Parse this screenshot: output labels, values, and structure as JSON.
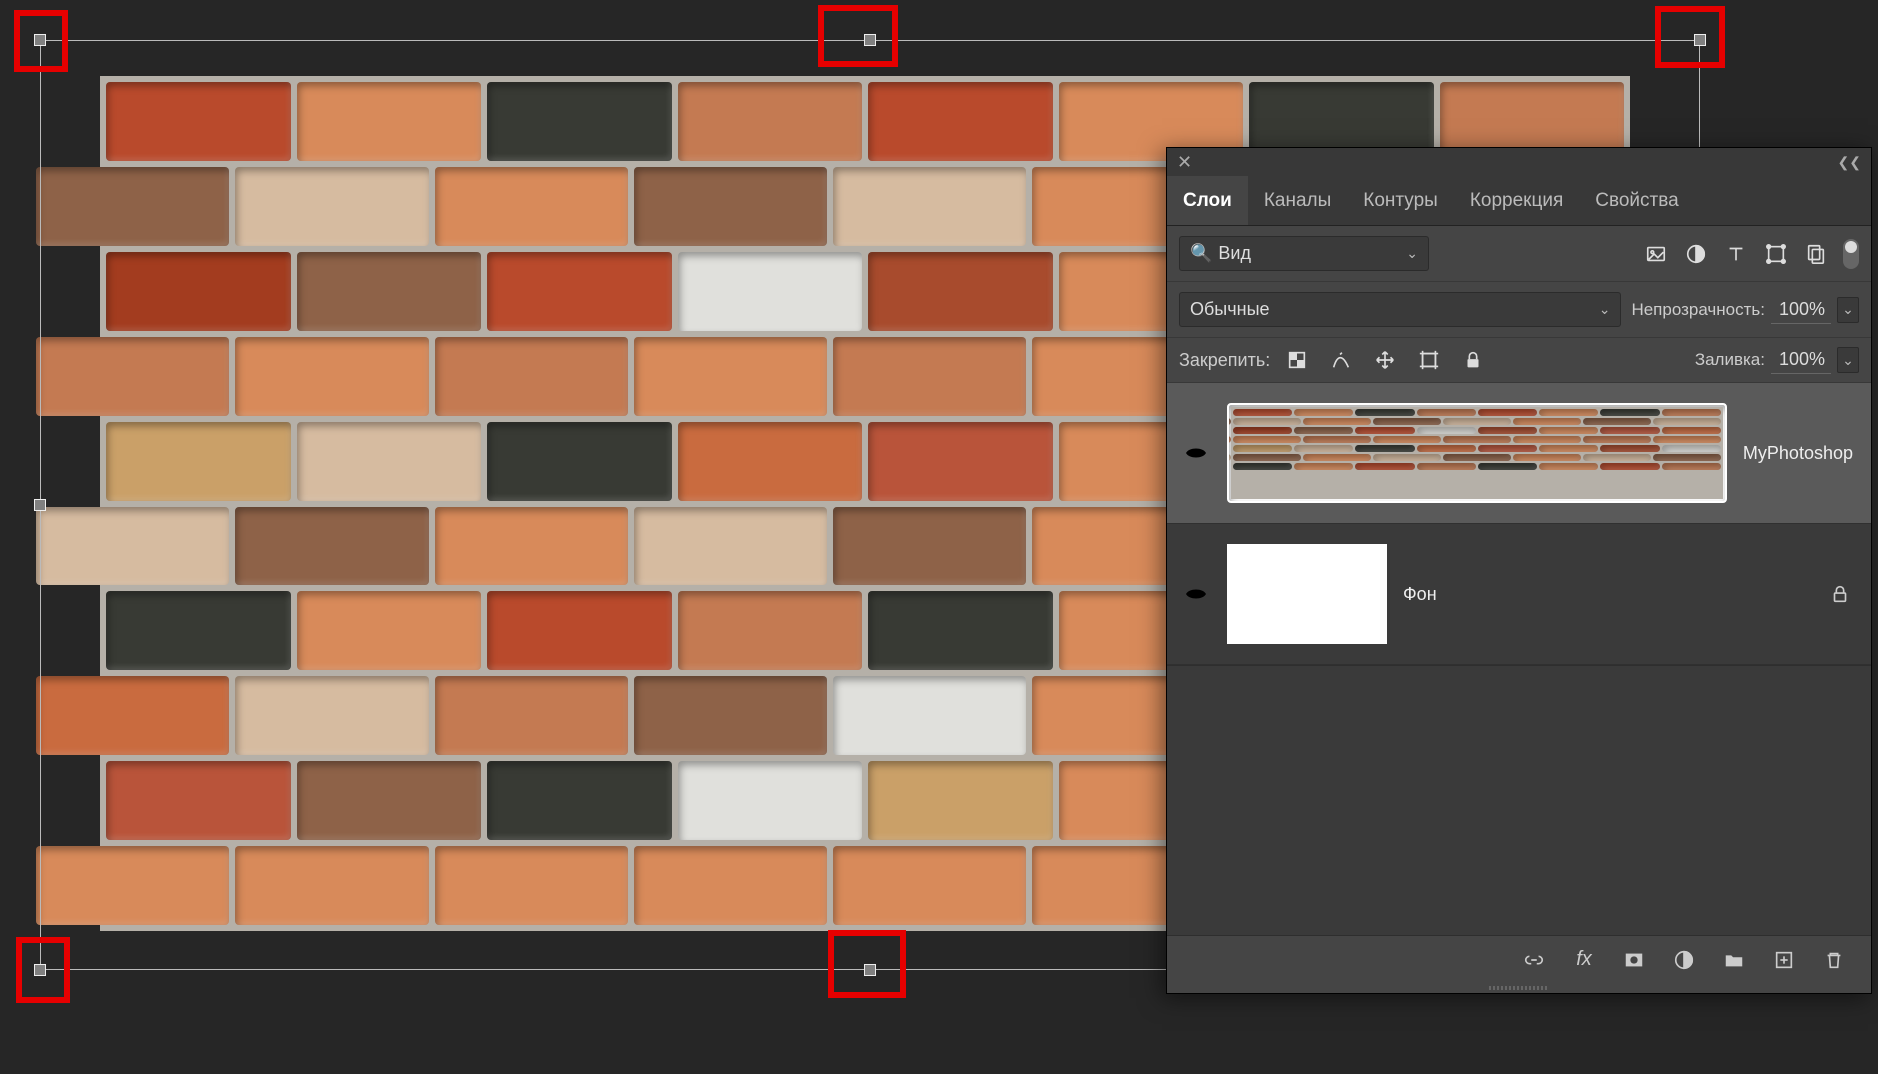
{
  "panel": {
    "tabs": [
      "Слои",
      "Каналы",
      "Контуры",
      "Коррекция",
      "Свойства"
    ],
    "active_tab": 0,
    "kind_filter": "Вид",
    "blend_mode": "Обычные",
    "opacity_label": "Непрозрачность:",
    "opacity_value": "100%",
    "fill_label": "Заливка:",
    "fill_value": "100%",
    "lock_label": "Закрепить:",
    "layers": [
      {
        "name": "MyPhotoshop",
        "visible": true,
        "selected": true,
        "thumb": "brick",
        "locked": false
      },
      {
        "name": "Фон",
        "visible": true,
        "selected": false,
        "thumb": "white",
        "locked": true
      }
    ]
  },
  "colors": {
    "highlight": "#e60000"
  }
}
